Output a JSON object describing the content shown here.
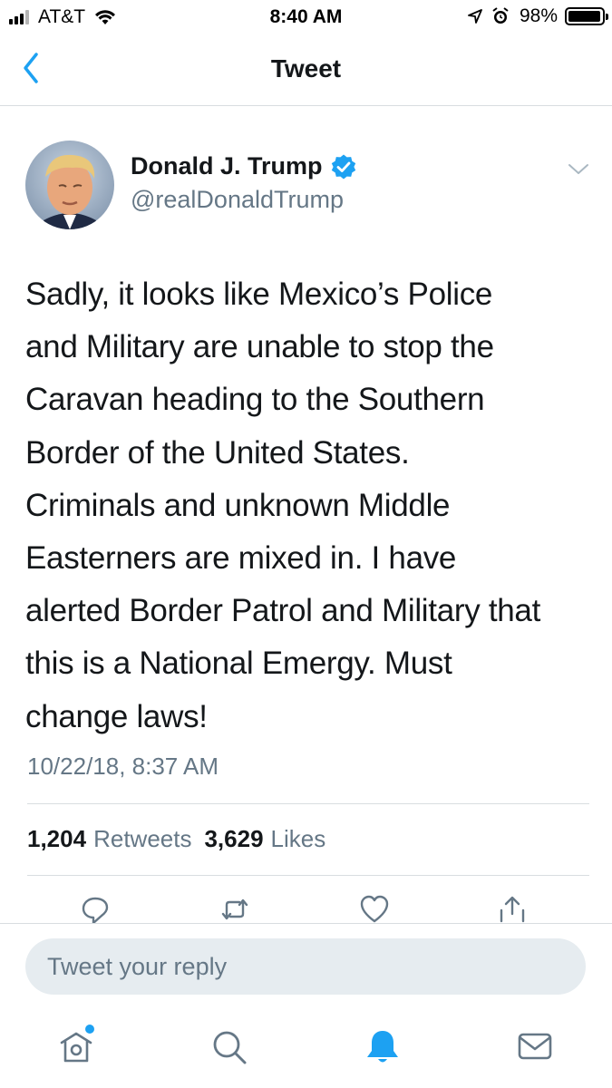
{
  "status_bar": {
    "carrier": "AT&T",
    "time": "8:40 AM",
    "battery_percent": "98%",
    "battery_level": 0.98,
    "signal_bars_filled": 3,
    "signal_bars_total": 4
  },
  "nav": {
    "title": "Tweet",
    "back_icon": "chevron-left-icon"
  },
  "tweet": {
    "author_name": "Donald J. Trump",
    "author_handle": "@realDonaldTrump",
    "verified": true,
    "text": "Sadly, it looks like Mexico’s Police\nand Military are unable to stop the\nCaravan heading to the Southern\nBorder of the United States.\nCriminals and unknown Middle\nEasterners are mixed in. I have\nalerted Border Patrol and Military that\nthis is a National Emergy. Must\nchange laws!",
    "timestamp": "10/22/18, 8:37 AM",
    "retweet_count": "1,204",
    "retweet_label": "Retweets",
    "like_count": "3,629",
    "like_label": "Likes"
  },
  "actions": [
    "reply-icon",
    "retweet-icon",
    "heart-icon",
    "share-icon"
  ],
  "reply": {
    "placeholder": "Tweet your reply"
  },
  "tab_bar": {
    "tabs": [
      "home-icon",
      "search-icon",
      "notifications-icon",
      "messages-icon"
    ],
    "active": "notifications-icon"
  },
  "colors": {
    "accent": "#1da1f2",
    "text_primary": "#14171a",
    "text_secondary": "#657786",
    "divider": "#d8dde0",
    "reply_bg": "#e6ecf0"
  }
}
